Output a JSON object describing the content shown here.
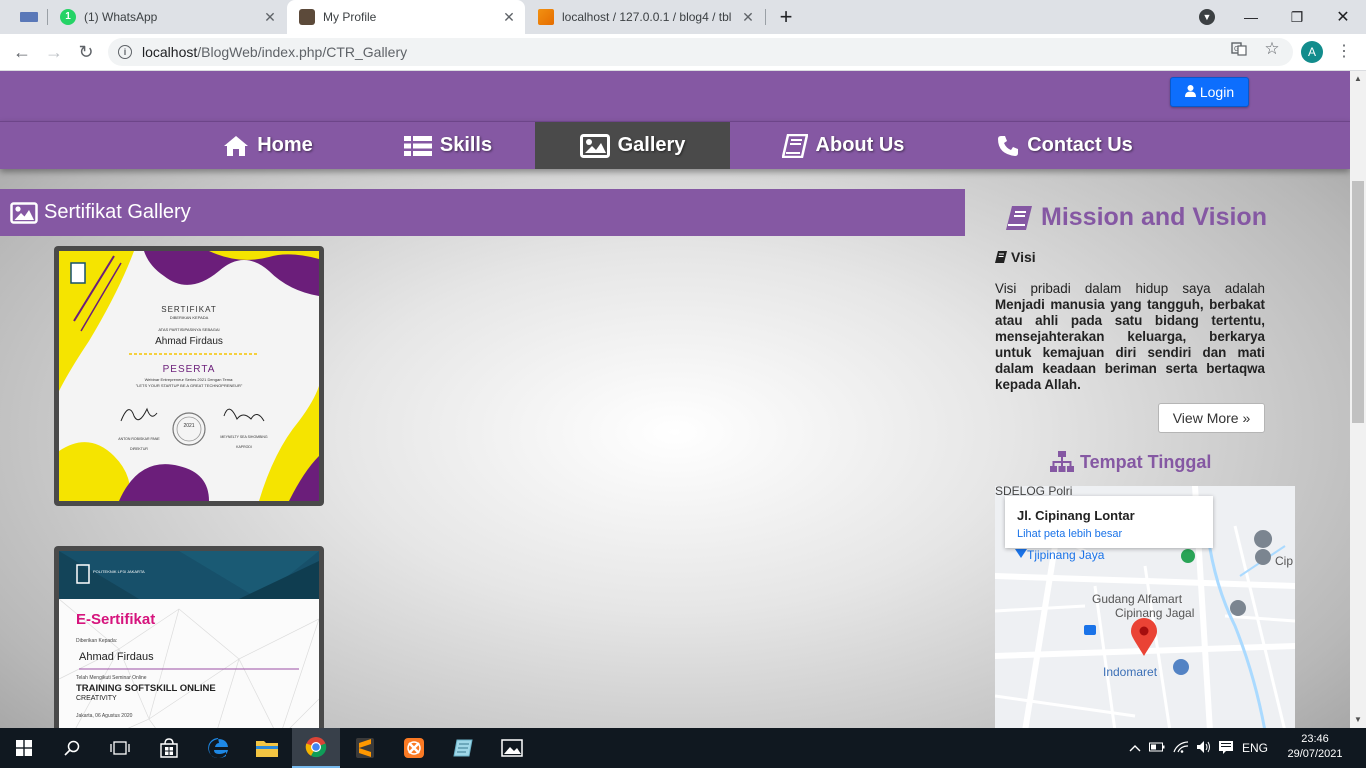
{
  "browser": {
    "tabs": [
      {
        "title": "",
        "active": false
      },
      {
        "title": "(1) WhatsApp",
        "active": false,
        "badge": "1"
      },
      {
        "title": "My Profile",
        "active": true
      },
      {
        "title": "localhost / 127.0.0.1 / blog4 / tbl",
        "active": false
      }
    ],
    "new_tab": "+",
    "url_host": "localhost",
    "url_path": "/BlogWeb/index.php/CTR_Gallery",
    "profile_initial": "A"
  },
  "header": {
    "login_label": "Login"
  },
  "nav": {
    "items": [
      {
        "label": "Home",
        "icon": "home-icon"
      },
      {
        "label": "Skills",
        "icon": "list-icon"
      },
      {
        "label": "Gallery",
        "icon": "image-icon",
        "active": true
      },
      {
        "label": "About Us",
        "icon": "book-icon"
      },
      {
        "label": "Contact Us",
        "icon": "phone-icon"
      }
    ]
  },
  "gallery": {
    "title": "Sertifikat Gallery",
    "cert1": {
      "title": "SERTIFIKAT",
      "subtitle": "DIBERIKAN KEPADA",
      "presented": "ATAS PARTISIPASINYA SEBAGAI",
      "name": "Ahmad Firdaus",
      "role": "PESERTA",
      "event": "Webinar Entrepreneur Series 2021 Dengan Tema:",
      "theme": "\"LETS YOUR STARTUP BE A GREAT TECHNOPRENEUR\"",
      "seal_year": "2021",
      "sig_left": "ANTON ROBISKAR PANE",
      "sig_left_role": "DIREKTUR",
      "sig_right": "MEYNELTY SEA SIHOMBING",
      "sig_right_role": "KAPRODI"
    },
    "cert2": {
      "org": "POLITEKNIK LP3I JAKARTA",
      "title": "E-Sertifikat",
      "given_to": "Diberikan Kepada:",
      "name": "Ahmad Firdaus",
      "followed": "Telah Mengikuti Seminar Online",
      "event": "TRAINING SOFTSKILL ONLINE",
      "topic": "CREATIVITY",
      "date": "Jakarta, 06 Agustus 2020"
    }
  },
  "sidebar": {
    "title": "Mission and Vision",
    "visi_label": "Visi",
    "visi_intro": "Visi pribadi dalam hidup saya adalah",
    "visi_bold": "Menjadi manusia yang tangguh, berbakat atau ahli pada satu bidang tertentu, mensejahterakan keluarga, berkarya untuk kemajuan diri sendiri dan mati dalam keadaan beriman serta bertaqwa kepada Allah.",
    "view_more": "View More »",
    "tempat_title": "Tempat Tinggal"
  },
  "map": {
    "place": "Jl. Cipinang Lontar",
    "link": "Lihat peta lebih besar",
    "labels": {
      "sdelog": "SDELOG Polri",
      "tjipinang": "Tjipinang Jaya",
      "cip": "Cip",
      "gudang1": "Gudang Alfamart",
      "gudang2": "Cipinang Jagal",
      "indomaret": "Indomaret"
    }
  },
  "taskbar": {
    "time": "23:46",
    "date": "29/07/2021",
    "lang": "ENG"
  },
  "colors": {
    "brand_purple": "#8558a3",
    "nav_active": "#4a4a4a",
    "login_blue": "#0d6efd"
  }
}
